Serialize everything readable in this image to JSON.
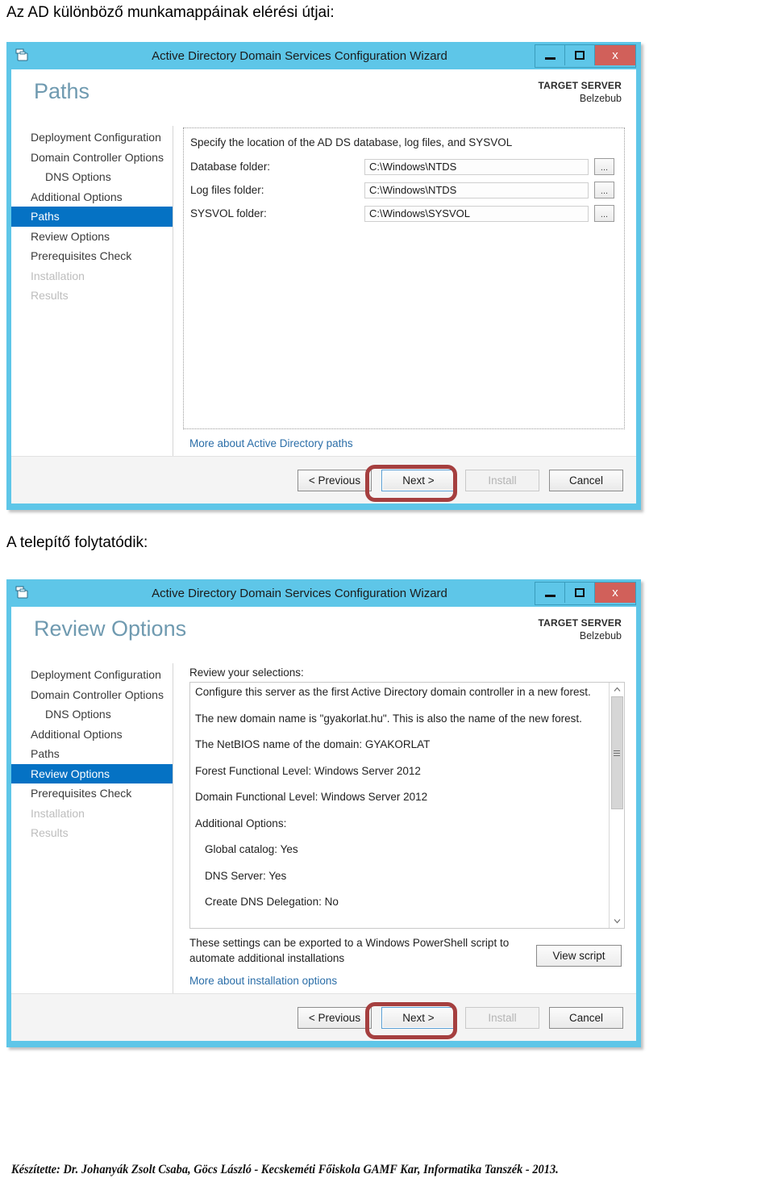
{
  "captions": {
    "first": "Az AD különböző munkamappáinak elérési útjai:",
    "second": "A telepítő folytatódik:"
  },
  "window_title": "Active Directory Domain Services Configuration Wizard",
  "window_controls": {
    "minimize": "minimize-icon",
    "maximize": "maximize-icon",
    "close": "x"
  },
  "target_server": {
    "label": "TARGET SERVER",
    "name": "Belzebub"
  },
  "nav_items": [
    {
      "label": "Deployment Configuration",
      "state": "normal",
      "indent": false
    },
    {
      "label": "Domain Controller Options",
      "state": "normal",
      "indent": false
    },
    {
      "label": "DNS Options",
      "state": "normal",
      "indent": true
    },
    {
      "label": "Additional Options",
      "state": "normal",
      "indent": false
    },
    {
      "label": "Paths",
      "state": "normal",
      "indent": false
    },
    {
      "label": "Review Options",
      "state": "normal",
      "indent": false
    },
    {
      "label": "Prerequisites Check",
      "state": "normal",
      "indent": false
    },
    {
      "label": "Installation",
      "state": "disabled",
      "indent": false
    },
    {
      "label": "Results",
      "state": "disabled",
      "indent": false
    }
  ],
  "paths_page": {
    "title": "Paths",
    "active_nav": "Paths",
    "intro": "Specify the location of the AD DS database, log files, and SYSVOL",
    "fields": [
      {
        "label": "Database folder:",
        "accel": "D",
        "value": "C:\\Windows\\NTDS",
        "browse": "..."
      },
      {
        "label": "Log files folder:",
        "accel": "L",
        "value": "C:\\Windows\\NTDS",
        "browse": "..."
      },
      {
        "label": "SYSVOL folder:",
        "accel": "S",
        "value": "C:\\Windows\\SYSVOL",
        "browse": "..."
      }
    ],
    "more_link": "More about Active Directory paths"
  },
  "review_page": {
    "title": "Review Options",
    "active_nav": "Review Options",
    "selections_label": "Review your selections:",
    "items": [
      {
        "text": "Configure this server as the first Active Directory domain controller in a new forest.",
        "sub": false
      },
      {
        "text": "The new domain name is \"gyakorlat.hu\". This is also the name of the new forest.",
        "sub": false
      },
      {
        "text": "The NetBIOS name of the domain: GYAKORLAT",
        "sub": false
      },
      {
        "text": "Forest Functional Level: Windows Server 2012",
        "sub": false
      },
      {
        "text": "Domain Functional Level: Windows Server 2012",
        "sub": false
      },
      {
        "text": "Additional Options:",
        "sub": false
      },
      {
        "text": "Global catalog: Yes",
        "sub": true
      },
      {
        "text": "DNS Server: Yes",
        "sub": true
      },
      {
        "text": "Create DNS Delegation: No",
        "sub": true
      }
    ],
    "export_text": "These settings can be exported to a Windows PowerShell script to automate additional installations",
    "view_script_label": "View script",
    "view_script_accel": "V",
    "more_link": "More about installation options",
    "scroll_up": "▲",
    "scroll_down": "▼"
  },
  "wizard_buttons": {
    "previous": "< Previous",
    "previous_accel": "P",
    "next": "Next >",
    "next_accel": "N",
    "install": "Install",
    "cancel": "Cancel"
  },
  "colors": {
    "titlebar": "#5ec6e8",
    "close_button": "#d1605a",
    "nav_active": "#0572c4",
    "page_title": "#6f9ab0",
    "link": "#2b6ea8",
    "highlight_ring": "#a53f3f"
  },
  "credit": "Készítette: Dr. Johanyák Zsolt Csaba, Göcs László - Kecskeméti Főiskola GAMF Kar, Informatika Tanszék - 2013."
}
